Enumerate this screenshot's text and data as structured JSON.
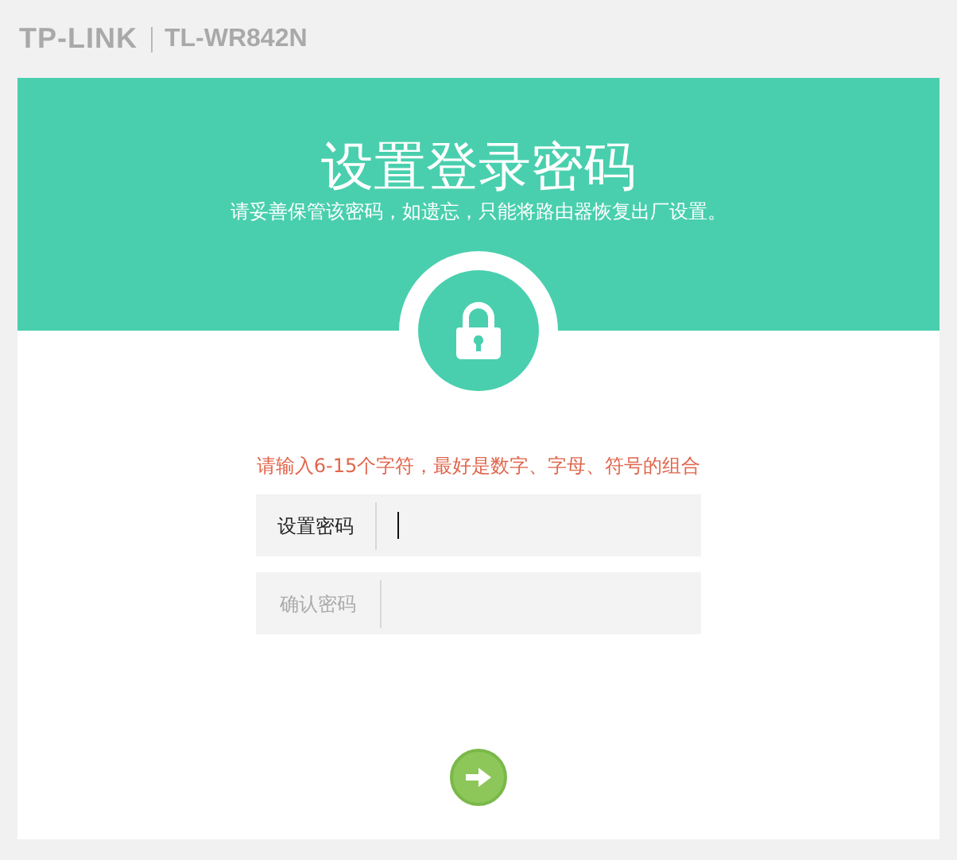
{
  "brand": {
    "logo": "TP-LINK",
    "model": "TL-WR842N"
  },
  "banner": {
    "title": "设置登录密码",
    "subtitle": "请妥善保管该密码，如遗忘，只能将路由器恢复出厂设置。"
  },
  "hint": "请输入6-15个字符，最好是数字、字母、符号的组合",
  "fields": [
    {
      "label": "设置密码",
      "active": true
    },
    {
      "label": "确认密码",
      "active": false
    }
  ]
}
